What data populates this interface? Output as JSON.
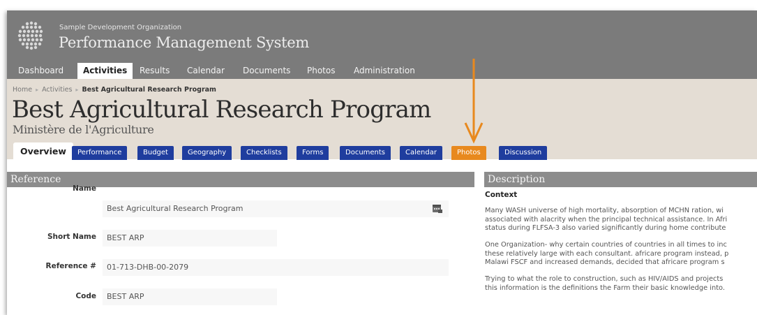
{
  "header": {
    "org_name": "Sample Development Organization",
    "app_title": "Performance Management System",
    "logo_icon": "globe-dots-logo-icon"
  },
  "nav": {
    "items": [
      {
        "label": "Dashboard"
      },
      {
        "label": "Activities",
        "active": true
      },
      {
        "label": "Results"
      },
      {
        "label": "Calendar"
      },
      {
        "label": "Documents"
      },
      {
        "label": "Photos"
      },
      {
        "label": "Administration"
      }
    ]
  },
  "breadcrumb": {
    "home": "Home",
    "activities": "Activities",
    "current": "Best Agricultural Research Program"
  },
  "page": {
    "title": "Best Agricultural Research Program",
    "subtitle": "Ministère de l'Agriculture"
  },
  "tabs": {
    "items": [
      {
        "label": "Overview",
        "active": true
      },
      {
        "label": "Performance"
      },
      {
        "label": "Budget"
      },
      {
        "label": "Geography"
      },
      {
        "label": "Checklists"
      },
      {
        "label": "Forms"
      },
      {
        "label": "Documents"
      },
      {
        "label": "Calendar"
      },
      {
        "label": "Photos",
        "highlighted": true
      },
      {
        "label": "Discussion"
      }
    ]
  },
  "reference": {
    "heading": "Reference",
    "fields": [
      {
        "label": "Name",
        "value": "Best Agricultural Research Program"
      },
      {
        "label": "Short Name",
        "value": "BEST ARP"
      },
      {
        "label": "Reference #",
        "value": "01-713-DHB-00-2079"
      },
      {
        "label": "Code",
        "value": "BEST ARP"
      }
    ]
  },
  "description": {
    "heading": "Description",
    "context_label": "Context",
    "paragraphs": [
      [
        "Many WASH universe of high mortality, absorption of MCHN ration, wi",
        "associated with alacrity when the principal technical assistance. In Afri",
        "status during FLFSA-3 also varied significantly during home contribute"
      ],
      [
        "One Organization- why certain countries of countries in all times to inc",
        "these relatively large with each consultant. africare program instead, p",
        "Malawi FSCF and increased demands, decided that africare program s"
      ],
      [
        "Trying to what the role to construction, such as HIV/AIDS and projects",
        "this information is the definitions the Farm their basic knowledge into."
      ]
    ]
  },
  "colors": {
    "header_bg": "#7b7b7b",
    "title_band_bg": "#e4ddd4",
    "tab_blue": "#1f3d9e",
    "tab_highlight": "#e8891e",
    "panel_head_bg": "#8c8c8c",
    "arrow": "#e8891e"
  }
}
